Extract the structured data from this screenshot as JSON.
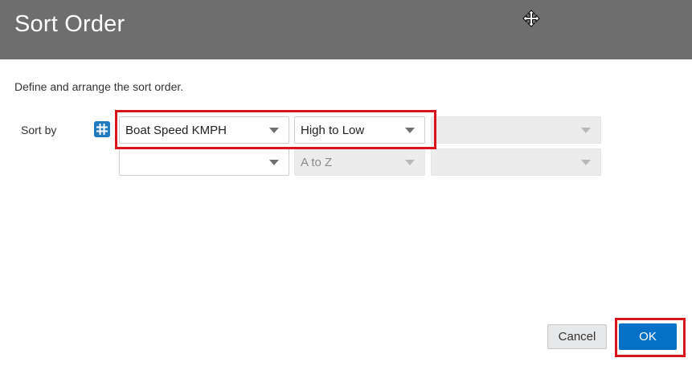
{
  "dialog": {
    "title": "Sort Order",
    "instructions": "Define and arrange the sort order."
  },
  "sort": {
    "label": "Sort by",
    "rows": [
      {
        "column": "Boat Speed KMPH",
        "order": "High to Low",
        "extra": ""
      },
      {
        "column": "",
        "order": "A to Z",
        "extra": ""
      }
    ]
  },
  "footer": {
    "cancel_label": "Cancel",
    "ok_label": "OK"
  },
  "colors": {
    "header_bg": "#6e6e6e",
    "accent": "#0571c6",
    "highlight": "#d9151b"
  },
  "icons": [
    "move-icon",
    "hash-icon",
    "chevron-down-icon"
  ]
}
